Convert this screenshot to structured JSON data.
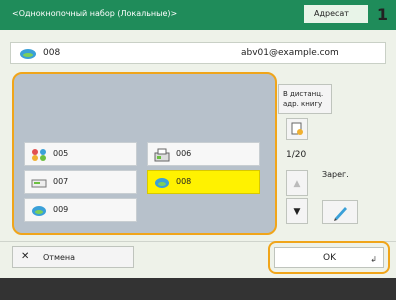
{
  "header": {
    "title": "<Однокнопочный набор (Локальные)>",
    "tab_label": "Адресат",
    "tab_number": "1"
  },
  "address_bar": {
    "number": "008",
    "email": "abv01@example.com",
    "icon": "email-icon"
  },
  "entries": [
    {
      "label": "005",
      "icon": "group-icon",
      "selected": false
    },
    {
      "label": "006",
      "icon": "fax-icon",
      "selected": false
    },
    {
      "label": "007",
      "icon": "scanner-icon",
      "selected": false
    },
    {
      "label": "008",
      "icon": "email-icon",
      "selected": true
    },
    {
      "label": "009",
      "icon": "email-icon",
      "selected": false
    }
  ],
  "side": {
    "dist_button": "В дистанц. адр. книгу",
    "page_indicator": "1/20",
    "register_label": "Зарег."
  },
  "footer": {
    "cancel_label": "Отмена",
    "ok_label": "OK"
  },
  "colors": {
    "header": "#1f8c5a",
    "highlight_border": "#f0a51a",
    "selected_entry": "#fff200"
  }
}
